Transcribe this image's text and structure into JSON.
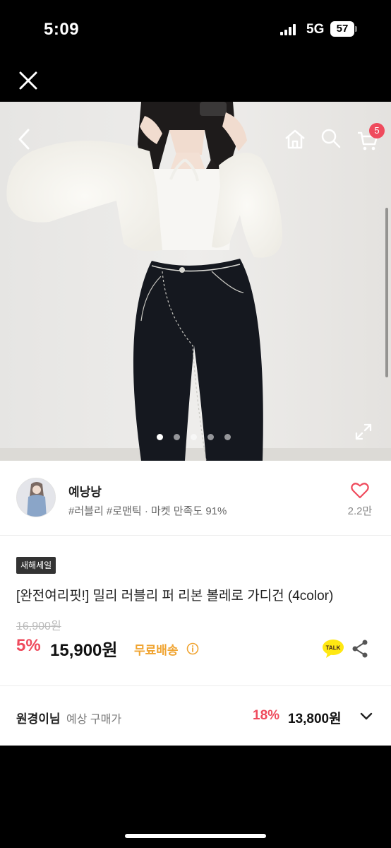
{
  "status_bar": {
    "time": "5:09",
    "network": "5G",
    "battery": "57",
    "icons": [
      "signal-icon",
      "battery-icon"
    ]
  },
  "top_bar": {
    "close_icon": "close-icon"
  },
  "hero": {
    "icons": [
      "back-icon",
      "home-icon",
      "search-icon",
      "cart-icon",
      "expand-icon"
    ],
    "cart_count": "5",
    "image_count": 5,
    "active_image_index": 0
  },
  "seller": {
    "name": "예낭낭",
    "tags": "#러블리 #로맨틱 · 마켓 만족도 91%",
    "like_count": "2.2만"
  },
  "product": {
    "badge": "새해세일",
    "title": "[완전여리핏!] 밀리 러블리 퍼 리본 볼레로 가디건 (4color)",
    "original_price": "16,900원",
    "discount": "5%",
    "price": "15,900원",
    "shipping": "무료배송",
    "talk_label": "TALK"
  },
  "expected_price": {
    "user_name": "원경이님",
    "label": "예상 구매가",
    "discount": "18%",
    "price": "13,800원"
  },
  "colors": {
    "accent_red": "#ef4b5d",
    "shipping_orange": "#f0a431",
    "badge_bg": "#333333",
    "kakao_yellow": "#ffe812"
  }
}
